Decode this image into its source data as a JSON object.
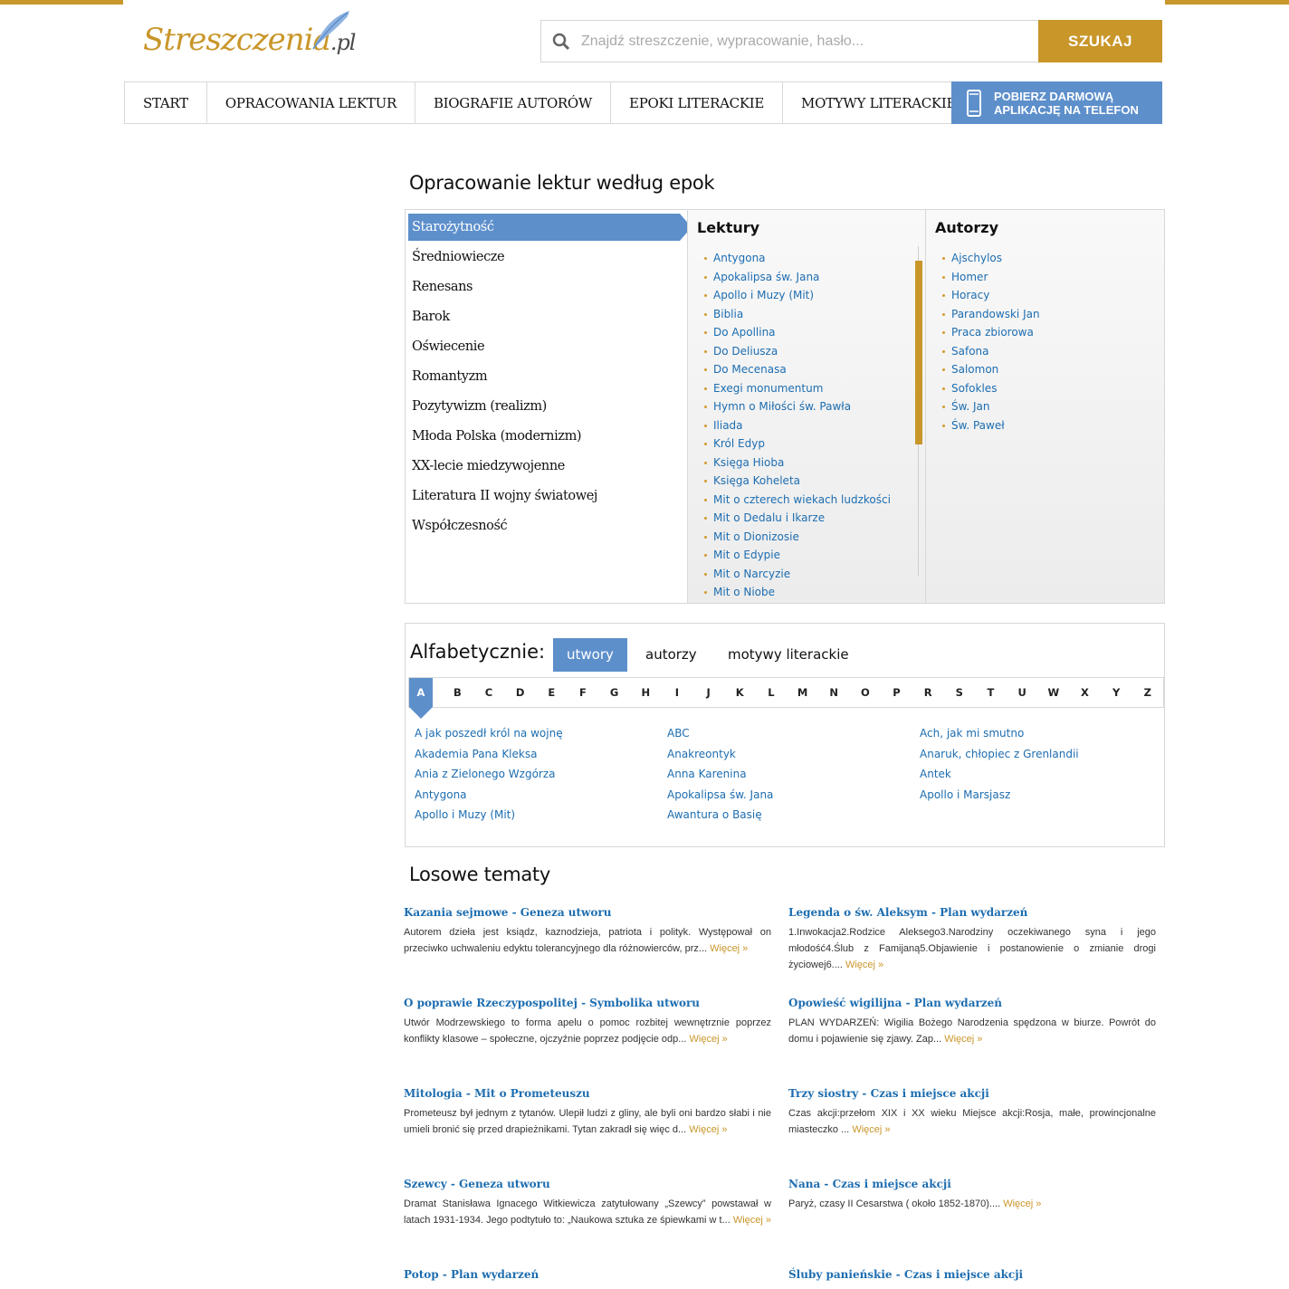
{
  "header": {
    "logo_text": "Streszczenia",
    "logo_suffix": ".pl",
    "search_placeholder": "Znajdź streszczenie, wypracowanie, hasło...",
    "search_button": "SZUKAJ"
  },
  "nav": {
    "items": [
      "START",
      "OPRACOWANIA LEKTUR",
      "BIOGRAFIE AUTORÓW",
      "EPOKI LITERACKIE",
      "MOTYWY LITERACKIE"
    ],
    "app_line1": "POBIERZ DARMOWĄ",
    "app_line2": "APLIKACJĘ NA TELEFON"
  },
  "epochs": {
    "title": "Opracowanie lektur według epok",
    "items": [
      "Starożytność",
      "Średniowiecze",
      "Renesans",
      "Barok",
      "Oświecenie",
      "Romantyzm",
      "Pozytywizm (realizm)",
      "Młoda Polska (modernizm)",
      "XX-lecie miedzywojenne",
      "Literatura II wojny światowej",
      "Współczesność"
    ],
    "works_title": "Lektury",
    "works": [
      "Antygona",
      "Apokalipsa św. Jana",
      "Apollo i Muzy (Mit)",
      "Biblia",
      "Do Apollina",
      "Do Deliusza",
      "Do Mecenasa",
      "Exegi monumentum",
      "Hymn o Miłości św. Pawła",
      "Iliada",
      "Król Edyp",
      "Księga Hioba",
      "Księga Koheleta",
      "Mit o czterech wiekach ludzkości",
      "Mit o Dedalu i Ikarze",
      "Mit o Dionizosie",
      "Mit o Edypie",
      "Mit o Narcyzie",
      "Mit o Niobe"
    ],
    "authors_title": "Autorzy",
    "authors": [
      "Ajschylos",
      "Homer",
      "Horacy",
      "Parandowski Jan",
      "Praca zbiorowa",
      "Safona",
      "Salomon",
      "Sofokles",
      "Św. Jan",
      "Św. Paweł"
    ]
  },
  "alphabet": {
    "title": "Alfabetycznie:",
    "tabs": [
      "utwory",
      "autorzy",
      "motywy literackie"
    ],
    "letters": [
      "A",
      "B",
      "C",
      "D",
      "E",
      "F",
      "G",
      "H",
      "I",
      "J",
      "K",
      "L",
      "M",
      "N",
      "O",
      "P",
      "R",
      "S",
      "T",
      "U",
      "W",
      "X",
      "Y",
      "Z"
    ],
    "col1": [
      "A jak poszedł król na wojnę",
      "Akademia Pana Kleksa",
      "Ania z Zielonego Wzgórza",
      "Antygona",
      "Apollo i Muzy (Mit)"
    ],
    "col2": [
      "ABC",
      "Anakreontyk",
      "Anna Karenina",
      "Apokalipsa św. Jana",
      "Awantura o Basię"
    ],
    "col3": [
      "Ach, jak mi smutno",
      "Anaruk, chłopiec z Grenlandii",
      "Antek",
      "Apollo i Marsjasz"
    ]
  },
  "random": {
    "title": "Losowe tematy",
    "more_label": "Więcej »",
    "topics": [
      {
        "title": "Kazania sejmowe - Geneza utworu",
        "text": "Autorem dzieła jest ksiądz, kaznodzieja, patriota i polityk. Występował on przeciwko uchwaleniu edyktu tolerancyjnego dla różnowierców, prz..."
      },
      {
        "title": "Legenda o św. Aleksym - Plan wydarzeń",
        "text": "1.Inwokacja2.Rodzice Aleksego3.Narodziny oczekiwanego syna i jego młodość4.Ślub z Famijaną5.Objawienie i postanowienie o zmianie drogi życiowej6...."
      },
      {
        "title": "O poprawie Rzeczypospolitej - Symbolika utworu",
        "text": "Utwór Modrzewskiego to forma apelu o pomoc rozbitej wewnętrznie poprzez konflikty klasowe – społeczne, ojczyźnie poprzez podjęcie odp..."
      },
      {
        "title": "Opowieść wigilijna - Plan wydarzeń",
        "text": "PLAN WYDARZEŃ: Wigilia Bożego Narodzenia spędzona w biurze. Powrót do domu i pojawienie się zjawy. Zap..."
      },
      {
        "title": "Mitologia - Mit o Prometeuszu",
        "text": "Prometeusz był jednym z tytanów. Ulepił ludzi z gliny, ale byli oni bardzo słabi i nie umieli bronić się przed drapieżnikami. Tytan zakradł się więc d..."
      },
      {
        "title": "Trzy siostry - Czas i miejsce akcji",
        "text": "Czas akcji:przełom XIX i XX wieku Miejsce akcji:Rosja, małe, prowincjonalne miasteczko ..."
      },
      {
        "title": "Szewcy - Geneza utworu",
        "text": "Dramat Stanisława Ignacego Witkiewicza zatytułowany „Szewcy” powstawał w latach 1931-1934. Jego podtytuło to: „Naukowa sztuka ze śpiewkami w t..."
      },
      {
        "title": "Nana - Czas i miejsce akcji",
        "text": "Paryż, czasy II Cesarstwa ( około 1852-1870)...."
      },
      {
        "title": "Potop - Plan wydarzeń",
        "text": ""
      },
      {
        "title": "Śluby panieńskie - Czas i miejsce akcji",
        "text": ""
      }
    ]
  }
}
